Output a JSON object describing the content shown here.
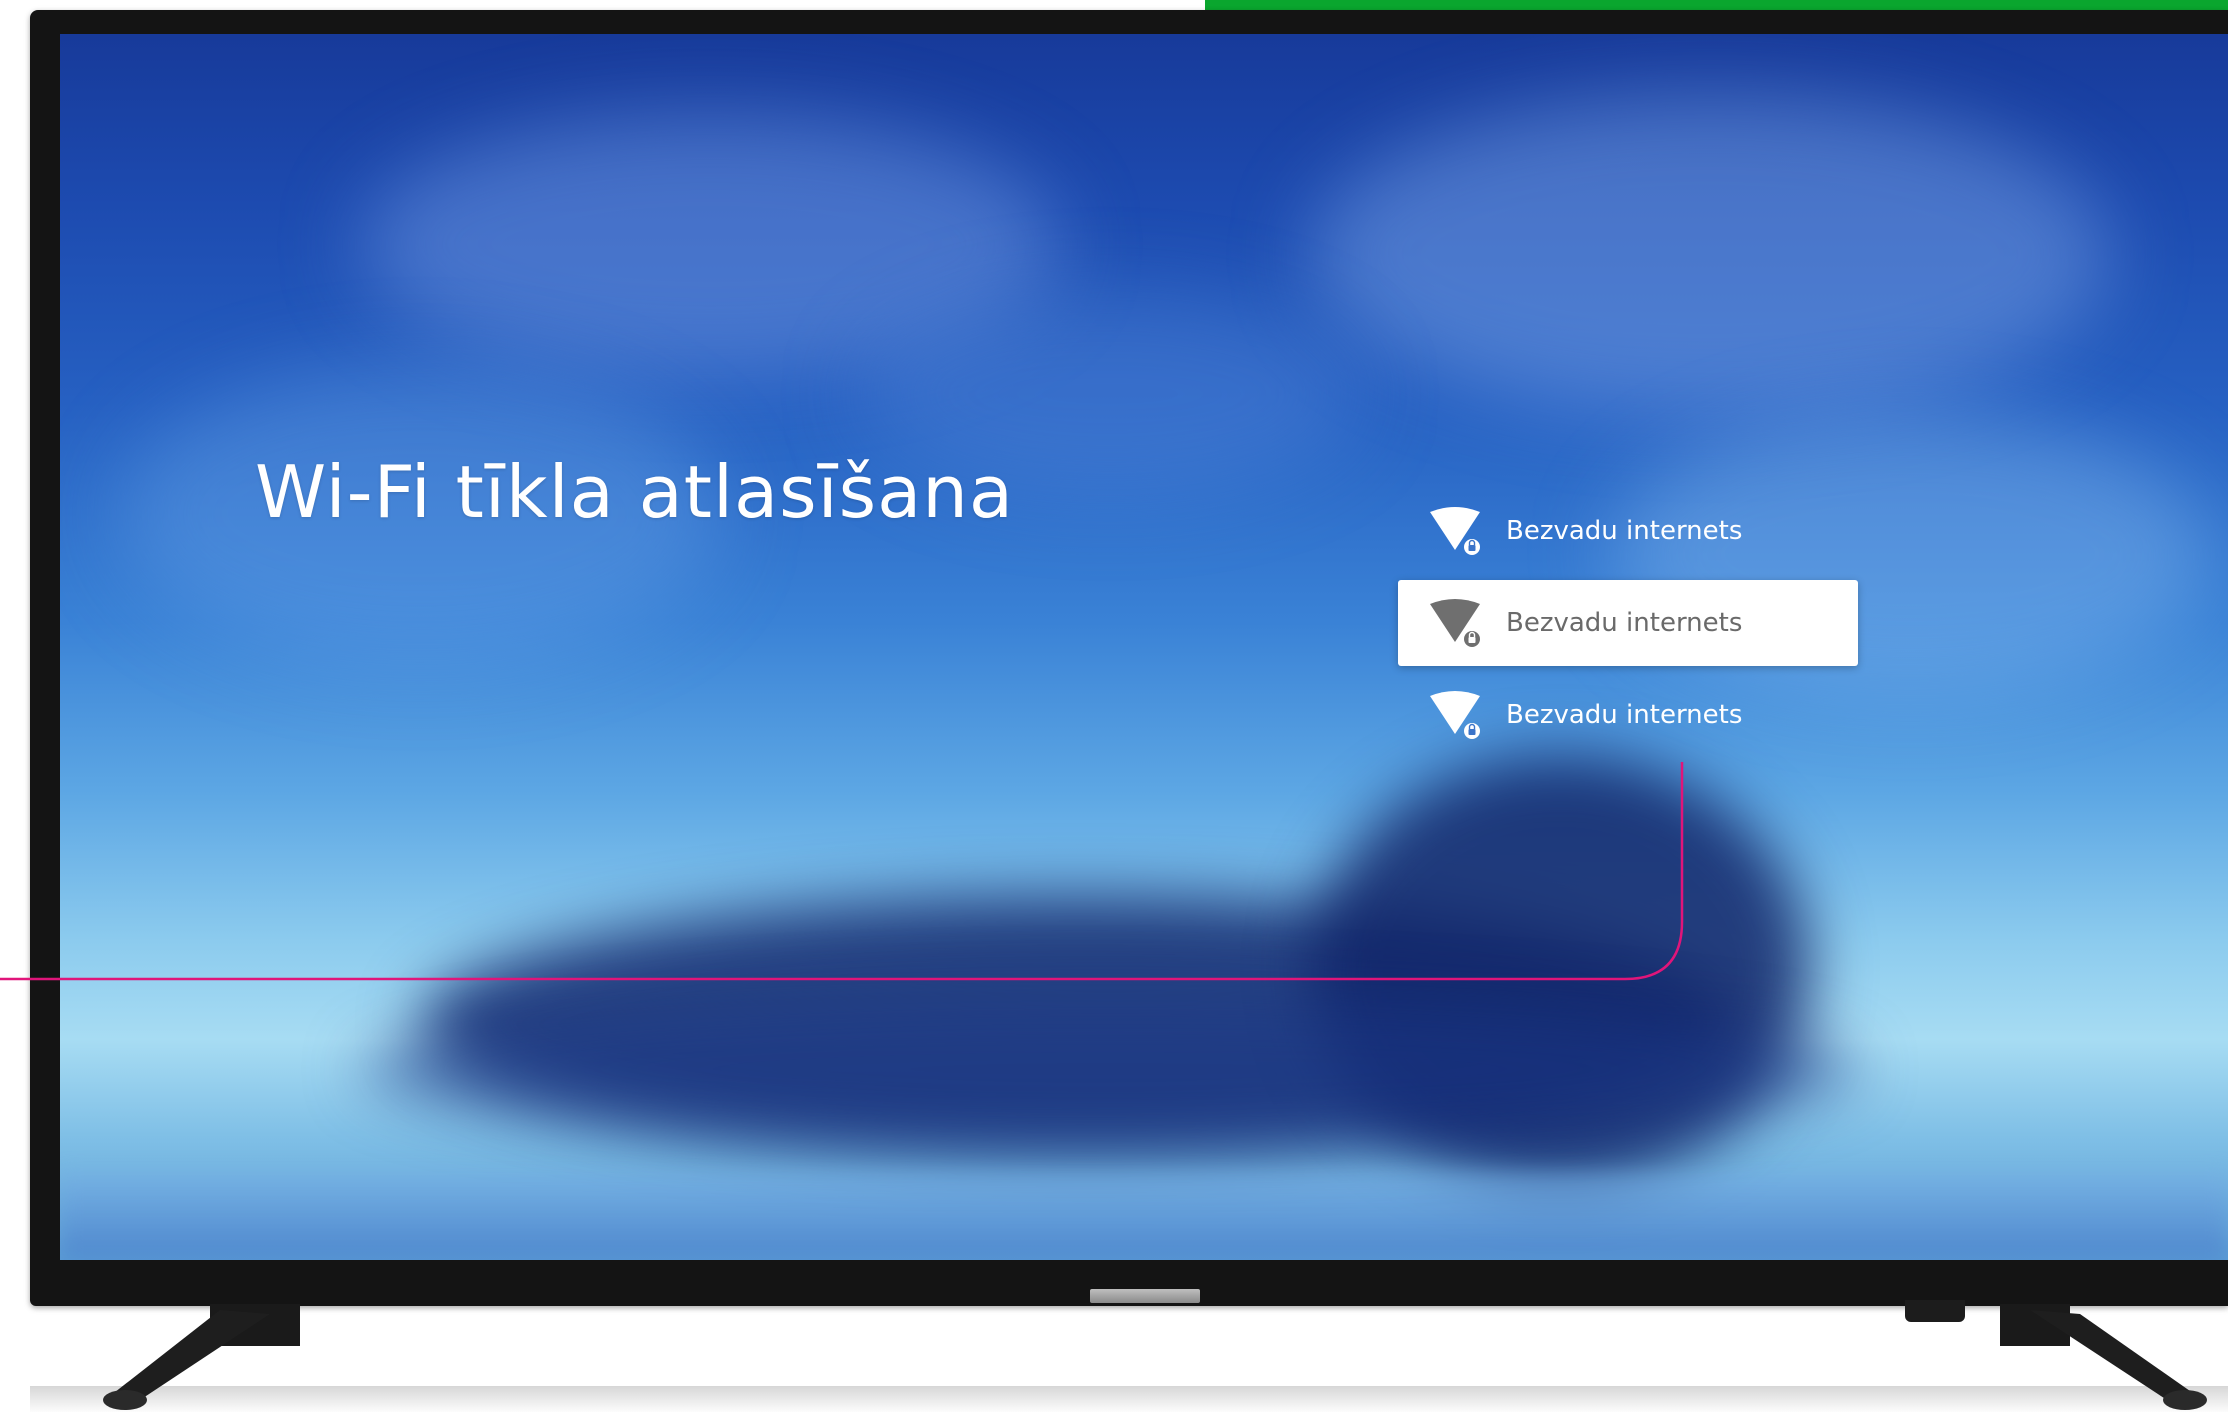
{
  "screen": {
    "title": "Wi-Fi tīkla atlasīšana"
  },
  "networks": [
    {
      "label": "Bezvadu internets",
      "icon": "wifi-lock-icon",
      "selected": false
    },
    {
      "label": "Bezvadu internets",
      "icon": "wifi-lock-icon",
      "selected": true
    },
    {
      "label": "Bezvadu internets",
      "icon": "wifi-lock-icon",
      "selected": false
    }
  ],
  "colors": {
    "accent_green": "#0aa62e",
    "callout_pink": "#e0157a",
    "selected_bg": "#ffffff",
    "screen_blue": "#1d4bb0"
  }
}
